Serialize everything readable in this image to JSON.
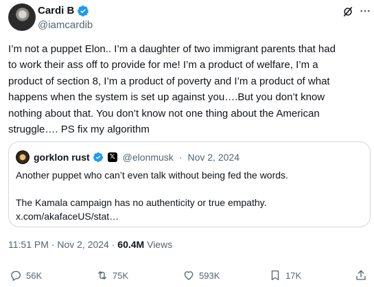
{
  "author": {
    "name": "Cardi B",
    "handle": "@iamcardib",
    "verified_color": "#1d9bf0"
  },
  "tweet": {
    "text": "I’m not a puppet Elon.. I’m a daughter of two immigrant parents that had\nto work their ass off to provide for me! I’m a product of welfare, I’m a\nproduct of section 8, I’m a product of poverty and I’m a product of what\nhappens when the system is set up against you….But you don’t know\nnothing about that. You don’t know not one thing about the American\nstruggle…. PS fix my algorithm"
  },
  "quoted": {
    "name": "gorklon rust",
    "x_badge": "𝕏",
    "handle": "@elonmusk",
    "separator": "·",
    "date": "Nov 2, 2024",
    "text": "Another puppet who can’t even talk without being fed the words.\n\nThe Kamala campaign has no authenticity or true empathy.\nx.com/akafaceUS/stat…"
  },
  "meta": {
    "time": "11:51 PM",
    "sep1": "·",
    "date": "Nov 2, 2024",
    "sep2": "·",
    "views_count": "60.4M",
    "views_label": "Views"
  },
  "actions": {
    "replies": "56K",
    "reposts": "75K",
    "likes": "593K",
    "bookmarks": "17K"
  },
  "icons": {
    "grok": "grok-icon",
    "more": "more-icon",
    "reply": "reply-icon",
    "repost": "repost-icon",
    "like": "like-icon",
    "bookmark": "bookmark-icon",
    "share": "share-icon"
  }
}
